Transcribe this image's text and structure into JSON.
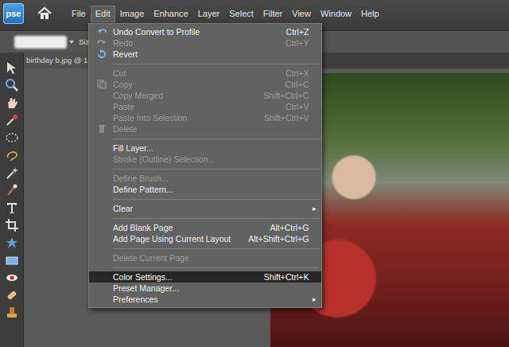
{
  "app": {
    "logo": "pse"
  },
  "menubar": [
    {
      "label": "File",
      "selected": false
    },
    {
      "label": "Edit",
      "selected": true
    },
    {
      "label": "Image",
      "selected": false
    },
    {
      "label": "Enhance",
      "selected": false
    },
    {
      "label": "Layer",
      "selected": false
    },
    {
      "label": "Select",
      "selected": false
    },
    {
      "label": "Filter",
      "selected": false
    },
    {
      "label": "View",
      "selected": false
    },
    {
      "label": "Window",
      "selected": false
    },
    {
      "label": "Help",
      "selected": false
    }
  ],
  "options_bar": {
    "size_label": "Size:"
  },
  "document_tab": {
    "label": "birthday b.jpg @ 1"
  },
  "edit_menu": {
    "groups": [
      [
        {
          "label": "Undo Convert to Profile",
          "shortcut": "Ctrl+Z",
          "disabled": false,
          "selected": false,
          "icon": "undo",
          "arrow": ""
        },
        {
          "label": "Redo",
          "shortcut": "Ctrl+Y",
          "disabled": true,
          "selected": false,
          "icon": "redo",
          "arrow": ""
        },
        {
          "label": "Revert",
          "shortcut": "",
          "disabled": false,
          "selected": false,
          "icon": "revert",
          "arrow": ""
        }
      ],
      [
        {
          "label": "Cut",
          "shortcut": "Ctrl+X",
          "disabled": true,
          "selected": false,
          "icon": "none",
          "arrow": ""
        },
        {
          "label": "Copy",
          "shortcut": "Ctrl+C",
          "disabled": true,
          "selected": false,
          "icon": "copy",
          "arrow": ""
        },
        {
          "label": "Copy Merged",
          "shortcut": "Shift+Ctrl+C",
          "disabled": true,
          "selected": false,
          "icon": "none",
          "arrow": ""
        },
        {
          "label": "Paste",
          "shortcut": "Ctrl+V",
          "disabled": true,
          "selected": false,
          "icon": "none",
          "arrow": ""
        },
        {
          "label": "Paste Into Selection",
          "shortcut": "Shift+Ctrl+V",
          "disabled": true,
          "selected": false,
          "icon": "none",
          "arrow": ""
        },
        {
          "label": "Delete",
          "shortcut": "",
          "disabled": true,
          "selected": false,
          "icon": "delete",
          "arrow": ""
        }
      ],
      [
        {
          "label": "Fill Layer...",
          "shortcut": "",
          "disabled": false,
          "selected": false,
          "icon": "none",
          "arrow": ""
        },
        {
          "label": "Stroke (Outline) Selection...",
          "shortcut": "",
          "disabled": true,
          "selected": false,
          "icon": "none",
          "arrow": ""
        }
      ],
      [
        {
          "label": "Define Brush...",
          "shortcut": "",
          "disabled": true,
          "selected": false,
          "icon": "none",
          "arrow": ""
        },
        {
          "label": "Define Pattern...",
          "shortcut": "",
          "disabled": false,
          "selected": false,
          "icon": "none",
          "arrow": ""
        }
      ],
      [
        {
          "label": "Clear",
          "shortcut": "",
          "disabled": false,
          "selected": false,
          "icon": "none",
          "arrow": "▸"
        }
      ],
      [
        {
          "label": "Add Blank Page",
          "shortcut": "Alt+Ctrl+G",
          "disabled": false,
          "selected": false,
          "icon": "none",
          "arrow": ""
        },
        {
          "label": "Add Page Using Current Layout",
          "shortcut": "Alt+Shift+Ctrl+G",
          "disabled": false,
          "selected": false,
          "icon": "none",
          "arrow": ""
        }
      ],
      [
        {
          "label": "Delete Current Page",
          "shortcut": "",
          "disabled": true,
          "selected": false,
          "icon": "none",
          "arrow": ""
        }
      ],
      [
        {
          "label": "Color Settings...",
          "shortcut": "Shift+Ctrl+K",
          "disabled": false,
          "selected": true,
          "icon": "none",
          "arrow": ""
        },
        {
          "label": "Preset Manager...",
          "shortcut": "",
          "disabled": false,
          "selected": false,
          "icon": "none",
          "arrow": ""
        },
        {
          "label": "Preferences",
          "shortcut": "",
          "disabled": false,
          "selected": false,
          "icon": "none",
          "arrow": "▸"
        }
      ]
    ]
  }
}
